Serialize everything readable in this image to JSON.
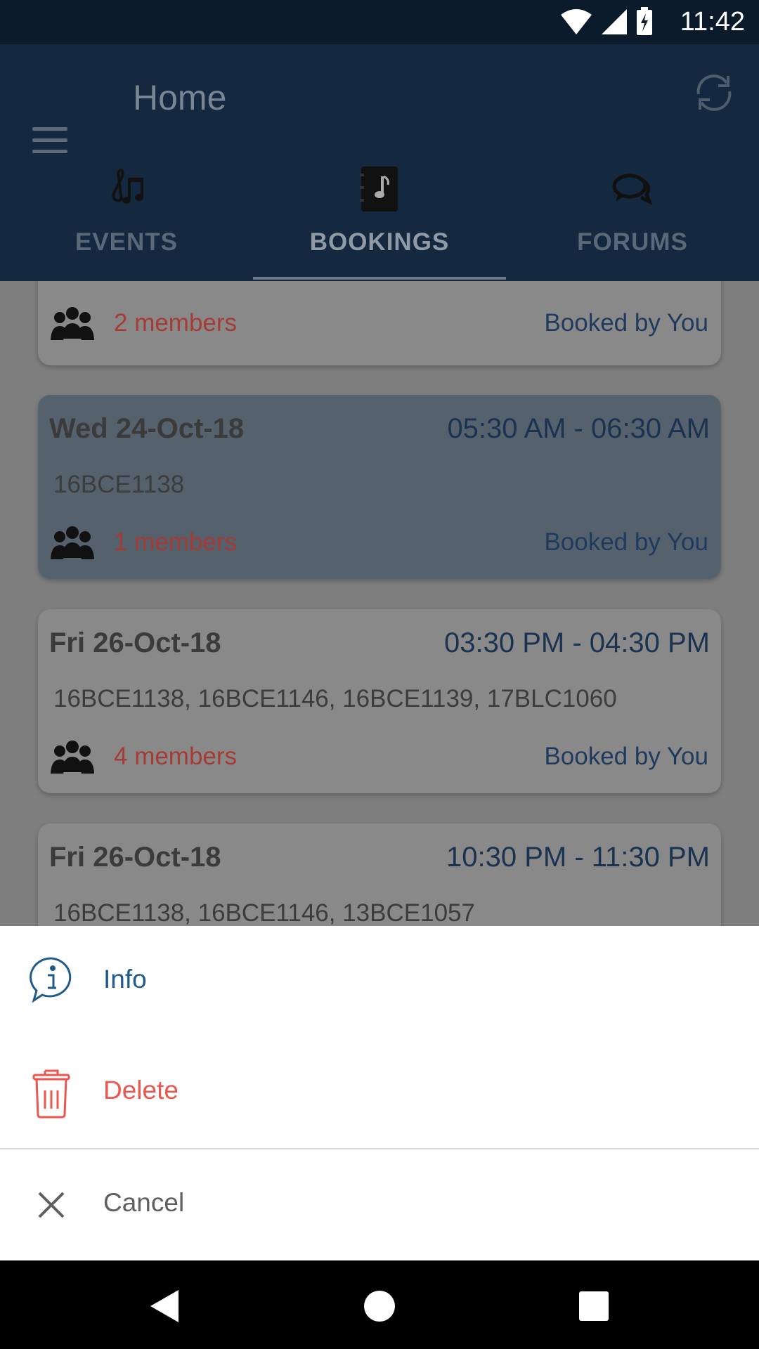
{
  "status_bar": {
    "time": "11:42"
  },
  "toolbar": {
    "title": "Home"
  },
  "tabs": [
    {
      "label": "EVENTS"
    },
    {
      "label": "BOOKINGS"
    },
    {
      "label": "FORUMS"
    }
  ],
  "bookings": [
    {
      "date": "",
      "time": "",
      "ids": "",
      "members": "2 members",
      "booked_by": "Booked by You"
    },
    {
      "date": "Wed 24-Oct-18",
      "time": "05:30 AM - 06:30 AM",
      "ids": "16BCE1138",
      "members": "1 members",
      "booked_by": "Booked by You"
    },
    {
      "date": "Fri 26-Oct-18",
      "time": "03:30 PM - 04:30 PM",
      "ids": "16BCE1138, 16BCE1146, 16BCE1139, 17BLC1060",
      "members": "4 members",
      "booked_by": "Booked by You"
    },
    {
      "date": "Fri 26-Oct-18",
      "time": "10:30 PM - 11:30 PM",
      "ids": "16BCE1138, 16BCE1146, 13BCE1057",
      "members": "",
      "booked_by": ""
    }
  ],
  "sheet": {
    "info_label": "Info",
    "delete_label": "Delete",
    "cancel_label": "Cancel"
  },
  "colors": {
    "info": "#1f5a8c",
    "delete": "#e9574f",
    "cancel": "#5f5f5f",
    "members": "#a63b35",
    "highlight_card": "#55626e"
  }
}
